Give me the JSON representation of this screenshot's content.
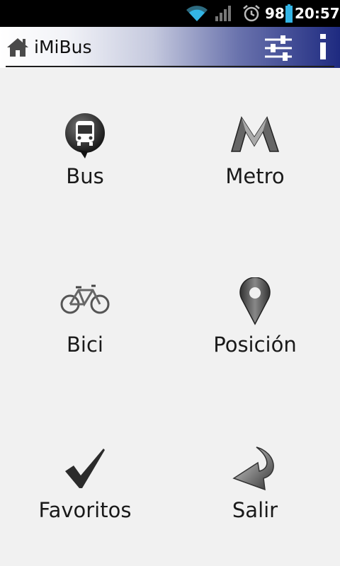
{
  "status_bar": {
    "battery_percent": "98",
    "time": "20:57",
    "icons": [
      "wifi-icon",
      "signal-icon",
      "alarm-icon",
      "battery-icon"
    ]
  },
  "app_bar": {
    "title": "iMiBus",
    "icons": [
      "home-icon",
      "sliders-icon",
      "info-icon"
    ]
  },
  "menu": {
    "items": [
      {
        "label": "Bus",
        "icon": "bus-icon"
      },
      {
        "label": "Metro",
        "icon": "metro-icon"
      },
      {
        "label": "Bici",
        "icon": "bicycle-icon"
      },
      {
        "label": "Posición",
        "icon": "location-pin-icon"
      },
      {
        "label": "Favoritos",
        "icon": "checkmark-icon"
      },
      {
        "label": "Salir",
        "icon": "back-arrow-icon"
      }
    ]
  }
}
